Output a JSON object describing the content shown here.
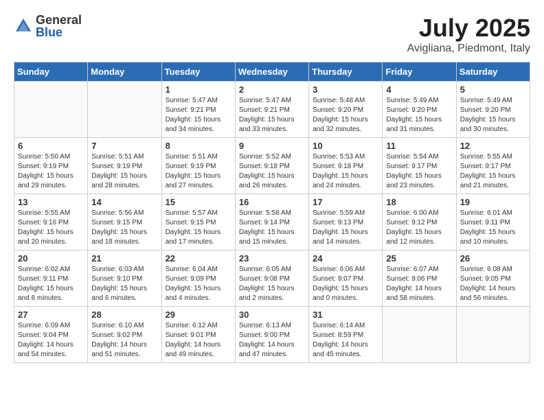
{
  "header": {
    "logo_general": "General",
    "logo_blue": "Blue",
    "month_title": "July 2025",
    "location": "Avigliana, Piedmont, Italy"
  },
  "weekdays": [
    "Sunday",
    "Monday",
    "Tuesday",
    "Wednesday",
    "Thursday",
    "Friday",
    "Saturday"
  ],
  "weeks": [
    [
      {
        "day": "",
        "content": ""
      },
      {
        "day": "",
        "content": ""
      },
      {
        "day": "1",
        "content": "Sunrise: 5:47 AM\nSunset: 9:21 PM\nDaylight: 15 hours\nand 34 minutes."
      },
      {
        "day": "2",
        "content": "Sunrise: 5:47 AM\nSunset: 9:21 PM\nDaylight: 15 hours\nand 33 minutes."
      },
      {
        "day": "3",
        "content": "Sunrise: 5:48 AM\nSunset: 9:20 PM\nDaylight: 15 hours\nand 32 minutes."
      },
      {
        "day": "4",
        "content": "Sunrise: 5:49 AM\nSunset: 9:20 PM\nDaylight: 15 hours\nand 31 minutes."
      },
      {
        "day": "5",
        "content": "Sunrise: 5:49 AM\nSunset: 9:20 PM\nDaylight: 15 hours\nand 30 minutes."
      }
    ],
    [
      {
        "day": "6",
        "content": "Sunrise: 5:50 AM\nSunset: 9:19 PM\nDaylight: 15 hours\nand 29 minutes."
      },
      {
        "day": "7",
        "content": "Sunrise: 5:51 AM\nSunset: 9:19 PM\nDaylight: 15 hours\nand 28 minutes."
      },
      {
        "day": "8",
        "content": "Sunrise: 5:51 AM\nSunset: 9:19 PM\nDaylight: 15 hours\nand 27 minutes."
      },
      {
        "day": "9",
        "content": "Sunrise: 5:52 AM\nSunset: 9:18 PM\nDaylight: 15 hours\nand 26 minutes."
      },
      {
        "day": "10",
        "content": "Sunrise: 5:53 AM\nSunset: 9:18 PM\nDaylight: 15 hours\nand 24 minutes."
      },
      {
        "day": "11",
        "content": "Sunrise: 5:54 AM\nSunset: 9:17 PM\nDaylight: 15 hours\nand 23 minutes."
      },
      {
        "day": "12",
        "content": "Sunrise: 5:55 AM\nSunset: 9:17 PM\nDaylight: 15 hours\nand 21 minutes."
      }
    ],
    [
      {
        "day": "13",
        "content": "Sunrise: 5:55 AM\nSunset: 9:16 PM\nDaylight: 15 hours\nand 20 minutes."
      },
      {
        "day": "14",
        "content": "Sunrise: 5:56 AM\nSunset: 9:15 PM\nDaylight: 15 hours\nand 18 minutes."
      },
      {
        "day": "15",
        "content": "Sunrise: 5:57 AM\nSunset: 9:15 PM\nDaylight: 15 hours\nand 17 minutes."
      },
      {
        "day": "16",
        "content": "Sunrise: 5:58 AM\nSunset: 9:14 PM\nDaylight: 15 hours\nand 15 minutes."
      },
      {
        "day": "17",
        "content": "Sunrise: 5:59 AM\nSunset: 9:13 PM\nDaylight: 15 hours\nand 14 minutes."
      },
      {
        "day": "18",
        "content": "Sunrise: 6:00 AM\nSunset: 9:12 PM\nDaylight: 15 hours\nand 12 minutes."
      },
      {
        "day": "19",
        "content": "Sunrise: 6:01 AM\nSunset: 9:11 PM\nDaylight: 15 hours\nand 10 minutes."
      }
    ],
    [
      {
        "day": "20",
        "content": "Sunrise: 6:02 AM\nSunset: 9:11 PM\nDaylight: 15 hours\nand 8 minutes."
      },
      {
        "day": "21",
        "content": "Sunrise: 6:03 AM\nSunset: 9:10 PM\nDaylight: 15 hours\nand 6 minutes."
      },
      {
        "day": "22",
        "content": "Sunrise: 6:04 AM\nSunset: 9:09 PM\nDaylight: 15 hours\nand 4 minutes."
      },
      {
        "day": "23",
        "content": "Sunrise: 6:05 AM\nSunset: 9:08 PM\nDaylight: 15 hours\nand 2 minutes."
      },
      {
        "day": "24",
        "content": "Sunrise: 6:06 AM\nSunset: 9:07 PM\nDaylight: 15 hours\nand 0 minutes."
      },
      {
        "day": "25",
        "content": "Sunrise: 6:07 AM\nSunset: 9:06 PM\nDaylight: 14 hours\nand 58 minutes."
      },
      {
        "day": "26",
        "content": "Sunrise: 6:08 AM\nSunset: 9:05 PM\nDaylight: 14 hours\nand 56 minutes."
      }
    ],
    [
      {
        "day": "27",
        "content": "Sunrise: 6:09 AM\nSunset: 9:04 PM\nDaylight: 14 hours\nand 54 minutes."
      },
      {
        "day": "28",
        "content": "Sunrise: 6:10 AM\nSunset: 9:02 PM\nDaylight: 14 hours\nand 51 minutes."
      },
      {
        "day": "29",
        "content": "Sunrise: 6:12 AM\nSunset: 9:01 PM\nDaylight: 14 hours\nand 49 minutes."
      },
      {
        "day": "30",
        "content": "Sunrise: 6:13 AM\nSunset: 9:00 PM\nDaylight: 14 hours\nand 47 minutes."
      },
      {
        "day": "31",
        "content": "Sunrise: 6:14 AM\nSunset: 8:59 PM\nDaylight: 14 hours\nand 45 minutes."
      },
      {
        "day": "",
        "content": ""
      },
      {
        "day": "",
        "content": ""
      }
    ]
  ]
}
